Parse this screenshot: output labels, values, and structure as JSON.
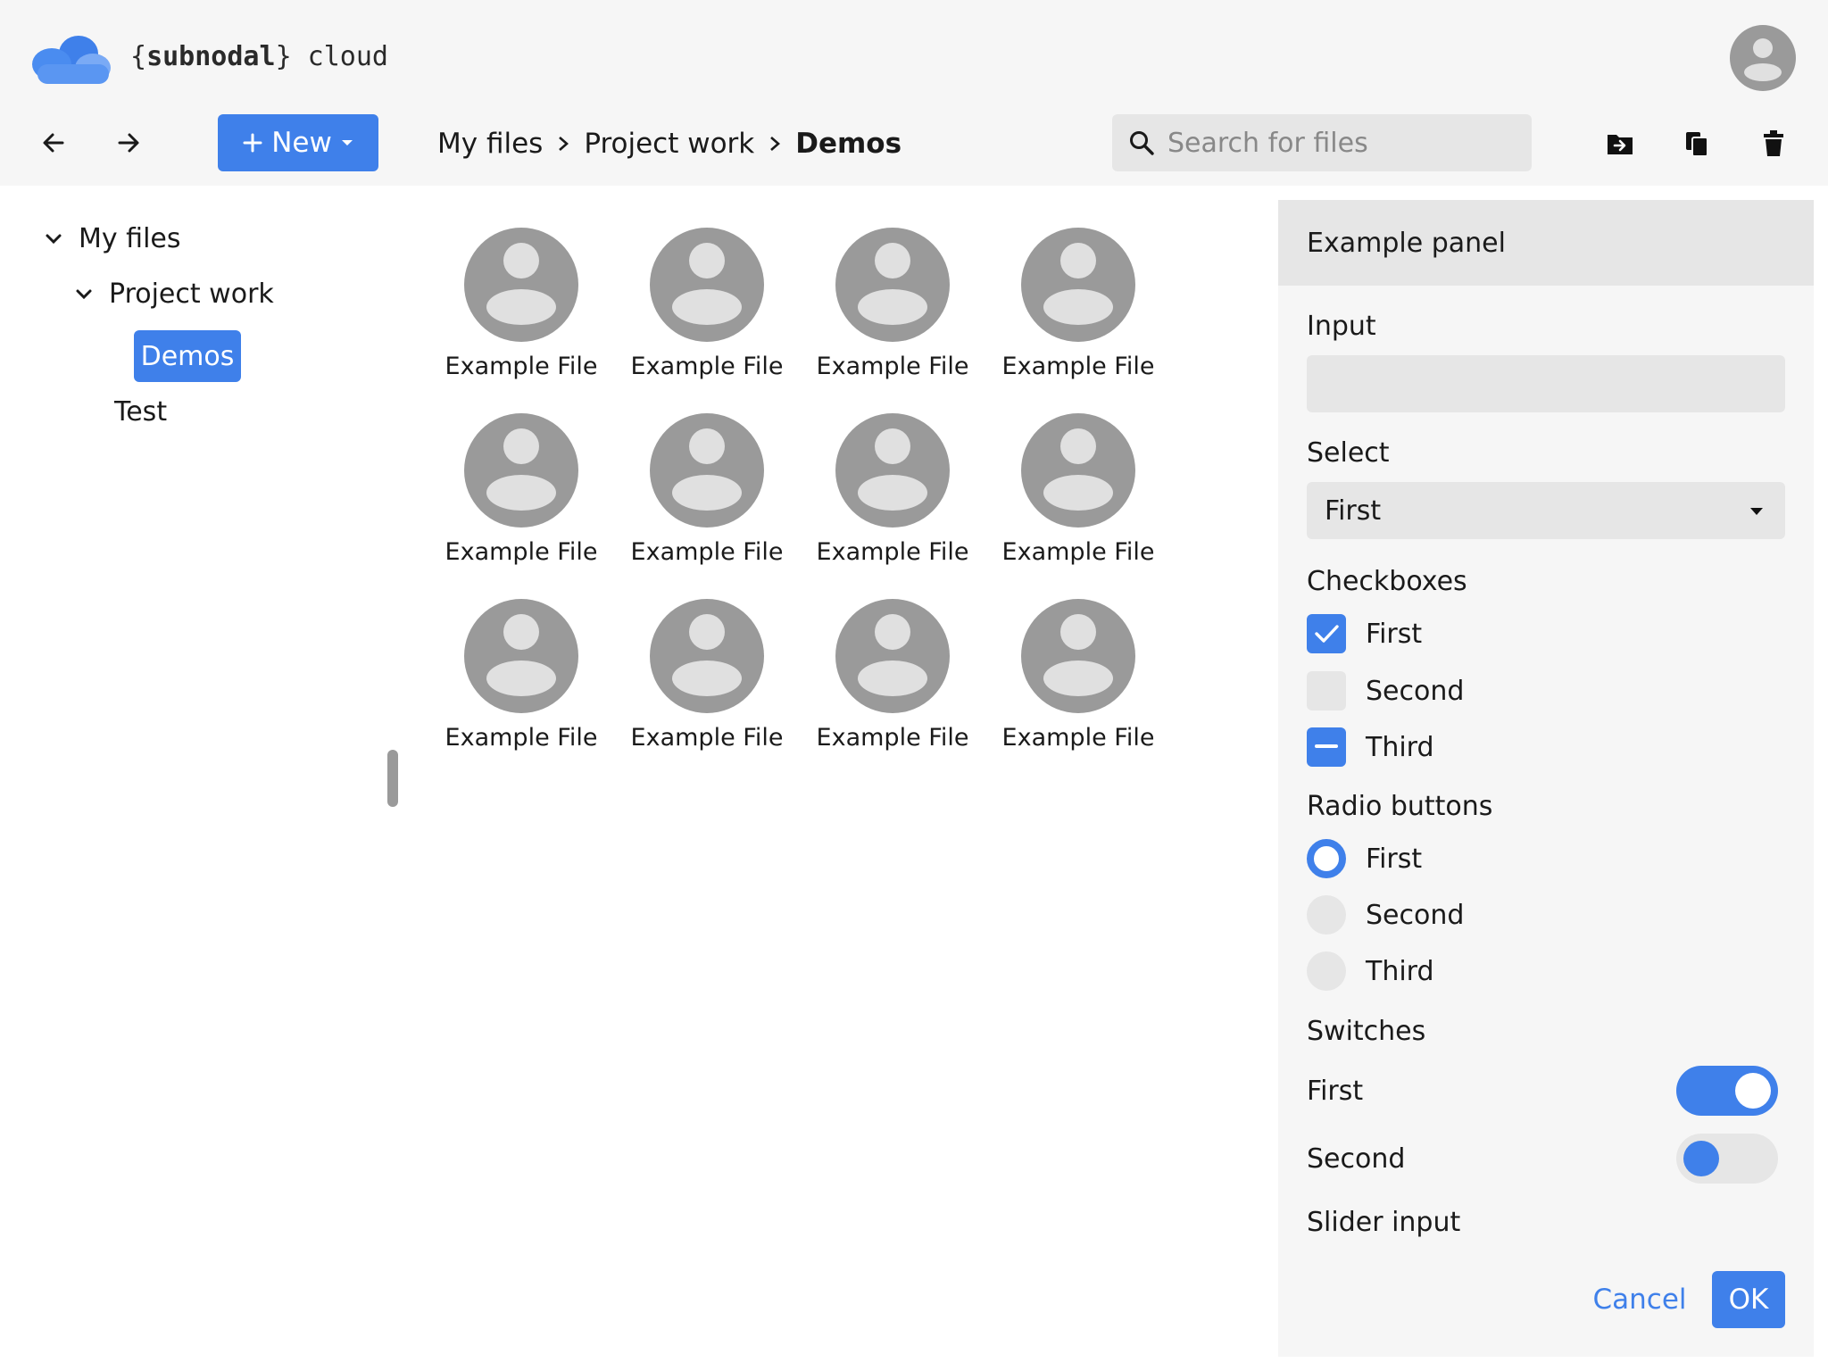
{
  "brand": {
    "open_brace": "{",
    "name": "subnodal",
    "close_brace": "}",
    "suffix": " cloud"
  },
  "toolbar": {
    "back_icon": "arrow-left-icon",
    "forward_icon": "arrow-right-icon",
    "new_label": "New",
    "breadcrumb": [
      "My files",
      "Project work",
      "Demos"
    ],
    "search_placeholder": "Search for files",
    "actions": [
      "move-to-folder-icon",
      "copy-icon",
      "delete-icon"
    ]
  },
  "tree": {
    "root": "My files",
    "child": "Project work",
    "selected": "Demos",
    "sibling": "Test"
  },
  "files": [
    "Example File",
    "Example File",
    "Example File",
    "Example File",
    "Example File",
    "Example File",
    "Example File",
    "Example File",
    "Example File",
    "Example File",
    "Example File",
    "Example File"
  ],
  "panel": {
    "title": "Example panel",
    "input_label": "Input",
    "input_value": "",
    "select_label": "Select",
    "select_value": "First",
    "checkboxes_label": "Checkboxes",
    "checkboxes": [
      {
        "label": "First",
        "state": "checked"
      },
      {
        "label": "Second",
        "state": "unchecked"
      },
      {
        "label": "Third",
        "state": "indeterminate"
      }
    ],
    "radios_label": "Radio buttons",
    "radios": [
      {
        "label": "First",
        "selected": true
      },
      {
        "label": "Second",
        "selected": false
      },
      {
        "label": "Third",
        "selected": false
      }
    ],
    "switches_label": "Switches",
    "switches": [
      {
        "label": "First",
        "on": true
      },
      {
        "label": "Second",
        "on": false
      }
    ],
    "slider_label": "Slider input",
    "cancel_label": "Cancel",
    "ok_label": "OK"
  },
  "colors": {
    "accent": "#3f80ea",
    "header_bg": "#f6f6f6",
    "field_bg": "#e6e6e6",
    "file_icon": "#9a9a9a"
  }
}
